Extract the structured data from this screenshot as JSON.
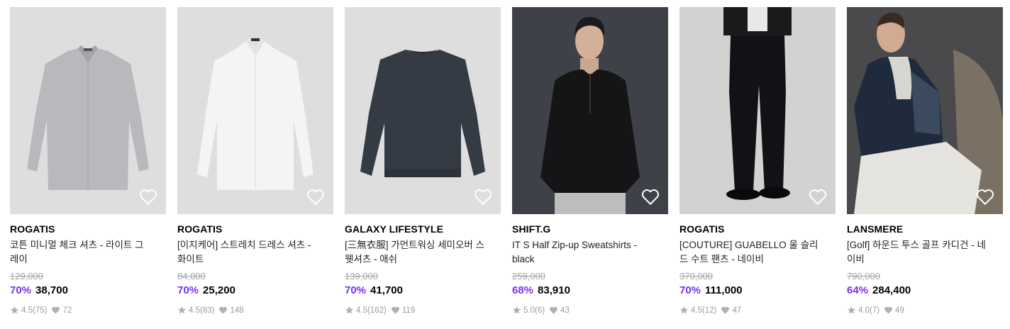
{
  "products": [
    {
      "brand": "ROGATIS",
      "name": "코튼 미니멀 체크 셔츠 - 라이트 그레이",
      "original_price": "129,000",
      "discount": "70%",
      "price": "38,700",
      "rating": "4.5(75)",
      "likes": "72"
    },
    {
      "brand": "ROGATIS",
      "name": "[이지케어] 스트레치 드레스 셔츠 - 화이트",
      "original_price": "84,000",
      "discount": "70%",
      "price": "25,200",
      "rating": "4.5(83)",
      "likes": "148"
    },
    {
      "brand": "GALAXY LIFESTYLE",
      "name": "[三無衣服] 가먼트워싱 세미오버 스웻셔츠 - 애쉬",
      "original_price": "139,000",
      "discount": "70%",
      "price": "41,700",
      "rating": "4.5(162)",
      "likes": "119"
    },
    {
      "brand": "SHIFT.G",
      "name": "IT S Half Zip-up Sweatshirts - black",
      "original_price": "259,000",
      "discount": "68%",
      "price": "83,910",
      "rating": "5.0(6)",
      "likes": "43"
    },
    {
      "brand": "ROGATIS",
      "name": "[COUTURE] GUABELLO 울 슬리드 수트 팬츠 - 네이비",
      "original_price": "370,000",
      "discount": "70%",
      "price": "111,000",
      "rating": "4.5(12)",
      "likes": "47"
    },
    {
      "brand": "LANSMERE",
      "name": "[Golf] 하운드 투스 골프 카디건 - 네이비",
      "original_price": "790,000",
      "discount": "64%",
      "price": "284,400",
      "rating": "4.0(7)",
      "likes": "49"
    }
  ],
  "icons": {
    "wishlist": "heart-outline-icon",
    "rating": "star-icon",
    "likes": "heart-filled-icon"
  },
  "colors": {
    "discount": "#7b2ff0",
    "muted": "#9a9a9a",
    "image_bg": "#dcdcdc"
  }
}
